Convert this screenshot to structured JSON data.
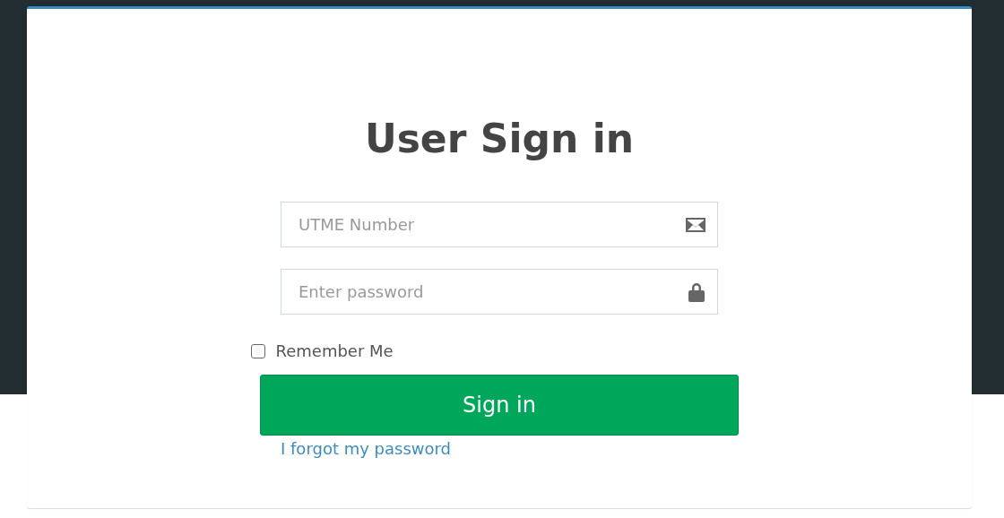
{
  "title": "User Sign in",
  "fields": [
    {
      "kind": "text",
      "placeholder": "UTME Number"
    },
    {
      "kind": "password",
      "placeholder": "Enter password"
    }
  ],
  "remember": {
    "label": "Remember Me",
    "checked": false
  },
  "submit": {
    "label": "Sign in"
  },
  "forgot_link": "I forgot my password"
}
